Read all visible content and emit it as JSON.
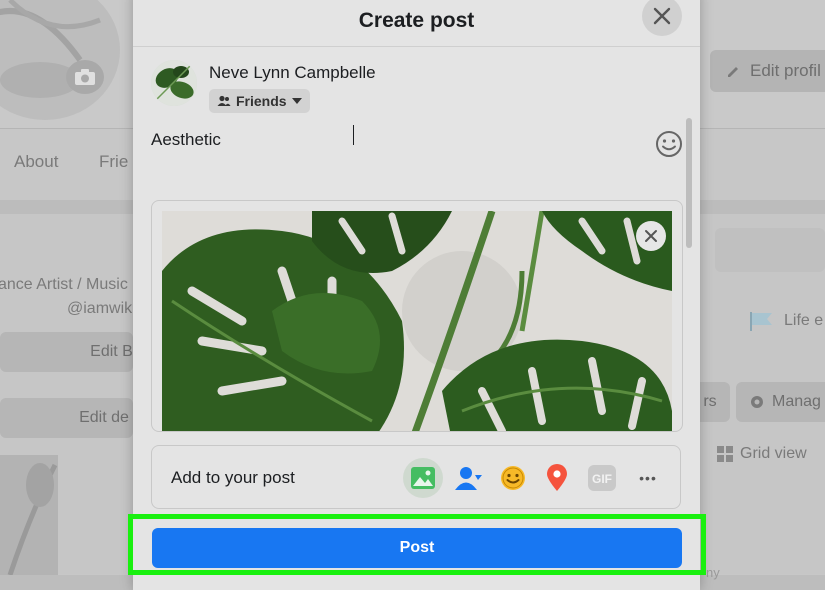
{
  "background": {
    "edit_profile_label": "Edit profil",
    "tabs": [
      "About",
      "Frie"
    ],
    "bio_line1": "ance Artist / Music",
    "bio_line2": "@iamwik",
    "edit_btn1": "Edit B",
    "edit_btn2": "Edit de",
    "life_event": "Life e",
    "filters": "rs",
    "manage": "Manag",
    "grid_view": "Grid view",
    "faded_bottom": "ny"
  },
  "modal": {
    "title": "Create post",
    "close_icon": "close-icon"
  },
  "user": {
    "name": "Neve Lynn Campbelle",
    "audience": "Friends"
  },
  "composer": {
    "text": "Aesthetic"
  },
  "add_to_post": {
    "label": "Add to your post",
    "gif_label": "GIF",
    "more_label": "•••"
  },
  "post_button": {
    "label": "Post"
  },
  "colors": {
    "accent": "#1877f2",
    "highlight": "#19f00f"
  }
}
